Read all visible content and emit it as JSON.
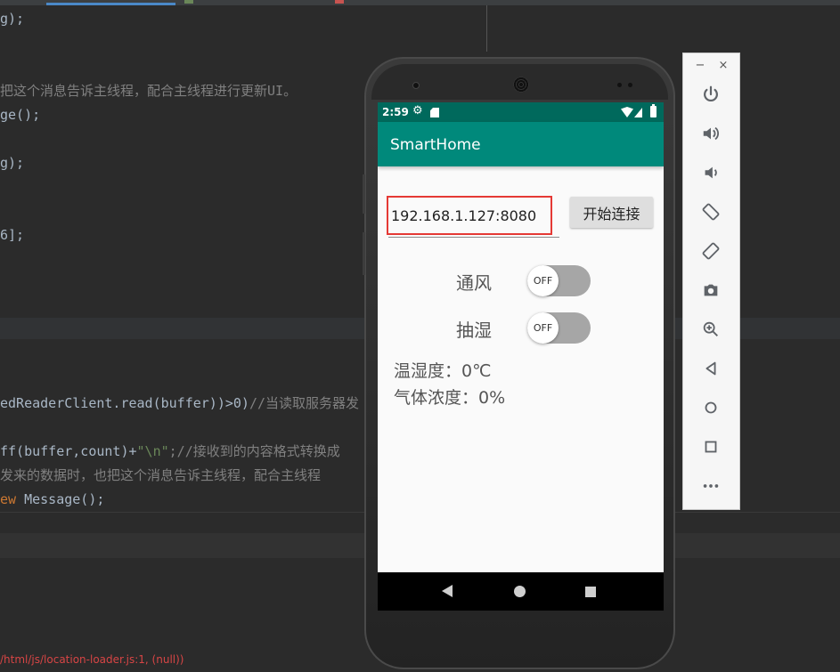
{
  "code_lines": [
    {
      "plain": "g);"
    },
    {
      "plain": "把这个消息告诉主线程，配合主线程进行更新UI。"
    },
    {
      "plain": "ge();"
    },
    {
      "plain": "g);"
    },
    {
      "plain": "6];"
    },
    {
      "code": "edReaderClient.read(buffer))>0)",
      "comment": "//当读取服务器发"
    },
    {
      "code": "ff(buffer,count)+",
      "string": "\"\\n\"",
      "comment": ";//接收到的内容格式转换成"
    },
    {
      "plain": "发来的数据时，也把这个消息告诉主线程，配合主线程"
    },
    {
      "keyword": "ew",
      "code": " Message();"
    }
  ],
  "log_text": "/html/js/location-loader.js:1, (null))",
  "status_bar": {
    "time": "2:59"
  },
  "app": {
    "title": "SmartHome"
  },
  "connection": {
    "address_value": "192.168.1.127:8080",
    "connect_label": "开始连接"
  },
  "switches": [
    {
      "label": "通风",
      "state": "OFF"
    },
    {
      "label": "抽湿",
      "state": "OFF"
    }
  ],
  "readings": {
    "temp_humidity": "温湿度：0℃",
    "gas_concentration": "气体浓度：0%"
  },
  "emulator_toolbar": {
    "minimize_glyph": "−",
    "close_glyph": "×",
    "buttons": [
      "power-icon",
      "volume-up-icon",
      "volume-down-icon",
      "rotate-left-icon",
      "rotate-right-icon",
      "camera-icon",
      "zoom-icon",
      "back-icon",
      "home-icon",
      "overview-icon",
      "more-icon"
    ]
  },
  "colors": {
    "status_bar": "#00695c",
    "app_bar": "#00897b",
    "highlight_box": "#e53935",
    "ide_background": "#2b2b2b"
  }
}
